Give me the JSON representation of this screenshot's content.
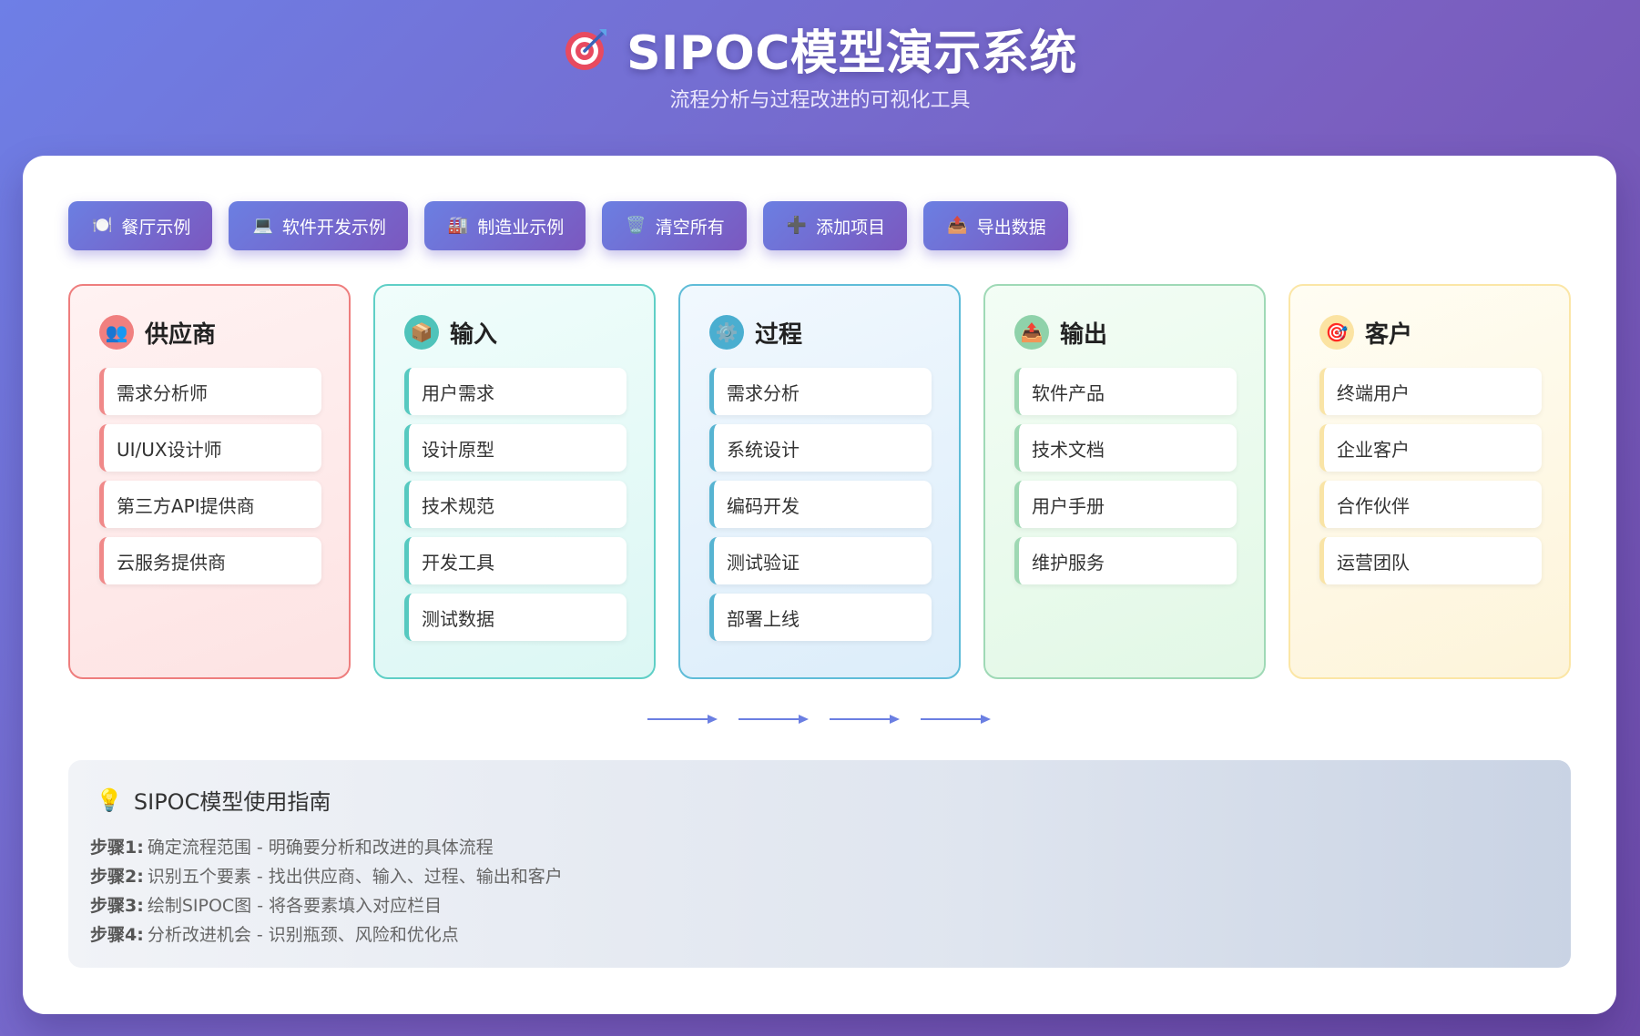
{
  "header": {
    "title": "SIPOC模型演示系统",
    "subtitle": "流程分析与过程改进的可视化工具",
    "icon": "target-icon"
  },
  "toolbar": [
    {
      "icon": "🍽️",
      "icon_name": "plate-icon",
      "label": "餐厅示例"
    },
    {
      "icon": "💻",
      "icon_name": "laptop-icon",
      "label": "软件开发示例"
    },
    {
      "icon": "🏭",
      "icon_name": "factory-icon",
      "label": "制造业示例"
    },
    {
      "icon": "🗑️",
      "icon_name": "trash-icon",
      "label": "清空所有"
    },
    {
      "icon": "➕",
      "icon_name": "plus-icon",
      "label": "添加项目"
    },
    {
      "icon": "📤",
      "icon_name": "export-icon",
      "label": "导出数据"
    }
  ],
  "columns": [
    {
      "key": "supplier",
      "title": "供应商",
      "icon": "👥",
      "icon_name": "people-icon",
      "border": "#ee7e7e",
      "bg_from": "#fff2f2",
      "bg_to": "#fde3e3",
      "accent": "#f08989",
      "badge_bg": "#f07f7f",
      "items": [
        "需求分析师",
        "UI/UX设计师",
        "第三方API提供商",
        "云服务提供商"
      ]
    },
    {
      "key": "input",
      "title": "输入",
      "icon": "📦",
      "icon_name": "box-icon",
      "border": "#5fcfc6",
      "bg_from": "#f0fdfb",
      "bg_to": "#dcf7f4",
      "accent": "#56c9c0",
      "badge_bg": "#4fc3ba",
      "items": [
        "用户需求",
        "设计原型",
        "技术规范",
        "开发工具",
        "测试数据"
      ]
    },
    {
      "key": "process",
      "title": "过程",
      "icon": "⚙️",
      "icon_name": "gear-icon",
      "border": "#5fbcd8",
      "bg_from": "#f1f8fe",
      "bg_to": "#dcedfa",
      "accent": "#57b4d2",
      "badge_bg": "#4aaed0",
      "items": [
        "需求分析",
        "系统设计",
        "编码开发",
        "测试验证",
        "部署上线"
      ]
    },
    {
      "key": "output",
      "title": "输出",
      "icon": "📤",
      "icon_name": "outbox-icon",
      "border": "#9fd9b6",
      "bg_from": "#f3fdf5",
      "bg_to": "#e2f8e6",
      "accent": "#9ed8b3",
      "badge_bg": "#8fd2aa",
      "items": [
        "软件产品",
        "技术文档",
        "用户手册",
        "维护服务"
      ]
    },
    {
      "key": "customer",
      "title": "客户",
      "icon": "🎯",
      "icon_name": "target-icon",
      "border": "#fbe6a6",
      "bg_from": "#fffdf3",
      "bg_to": "#fdf4da",
      "accent": "#f9e4a6",
      "badge_bg": "#fbe3a2",
      "items": [
        "终端用户",
        "企业客户",
        "合作伙伴",
        "运营团队"
      ]
    }
  ],
  "flow": {
    "arrow_color": "#6b7fe2",
    "count": 4
  },
  "guide": {
    "icon": "💡",
    "title": "SIPOC模型使用指南",
    "steps": [
      {
        "label": "步骤1:",
        "text": "确定流程范围 - 明确要分析和改进的具体流程"
      },
      {
        "label": "步骤2:",
        "text": "识别五个要素 - 找出供应商、输入、过程、输出和客户"
      },
      {
        "label": "步骤3:",
        "text": "绘制SIPOC图 - 将各要素填入对应栏目"
      },
      {
        "label": "步骤4:",
        "text": "分析改进机会 - 识别瓶颈、风险和优化点"
      }
    ]
  },
  "colors": {
    "primary": "#6b7fe2",
    "secondary": "#7b58bf"
  }
}
